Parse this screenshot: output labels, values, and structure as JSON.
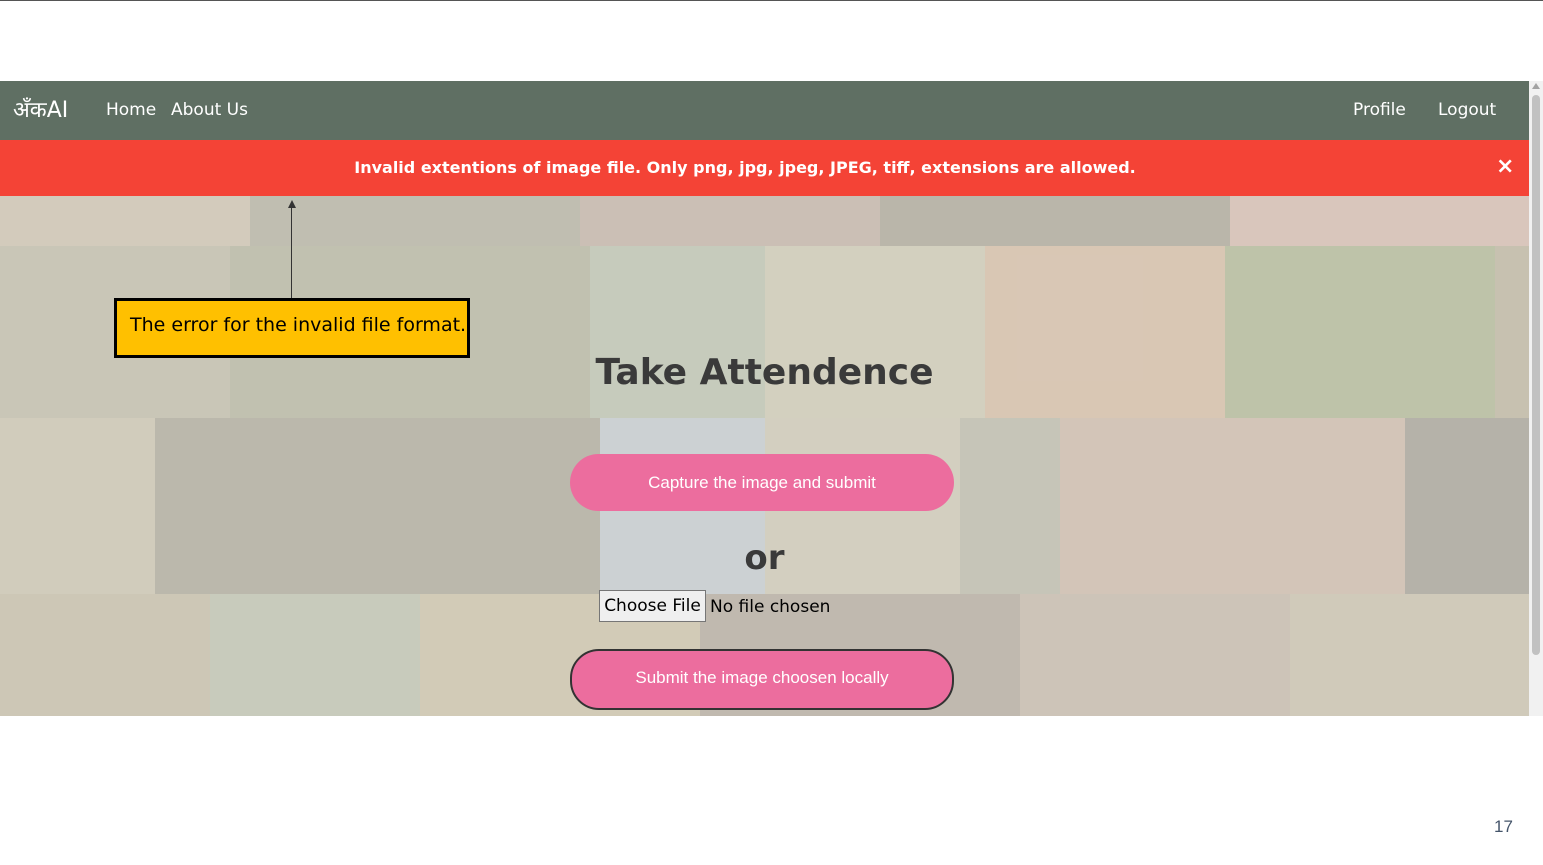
{
  "navbar": {
    "brand": "अँकAI",
    "left_links": [
      "Home",
      "About Us"
    ],
    "right_links": [
      "Profile",
      "Logout"
    ],
    "background": "#5f6f63"
  },
  "alert": {
    "message": "Invalid extentions of image file. Only png, jpg, jpeg, JPEG, tiff, extensions are allowed.",
    "close_symbol": "×",
    "background": "#f44336"
  },
  "main": {
    "title": "Take Attendence",
    "capture_button": "Capture the image and submit",
    "or_text": "or",
    "file_input": {
      "button_label": "Choose File",
      "status": "No file chosen"
    },
    "submit_button": "Submit the image choosen locally",
    "button_color": "#ec6d9e"
  },
  "annotation": {
    "text": "The error for the invalid file format.",
    "background": "#ffc000"
  },
  "slide": {
    "page_number": "17"
  }
}
